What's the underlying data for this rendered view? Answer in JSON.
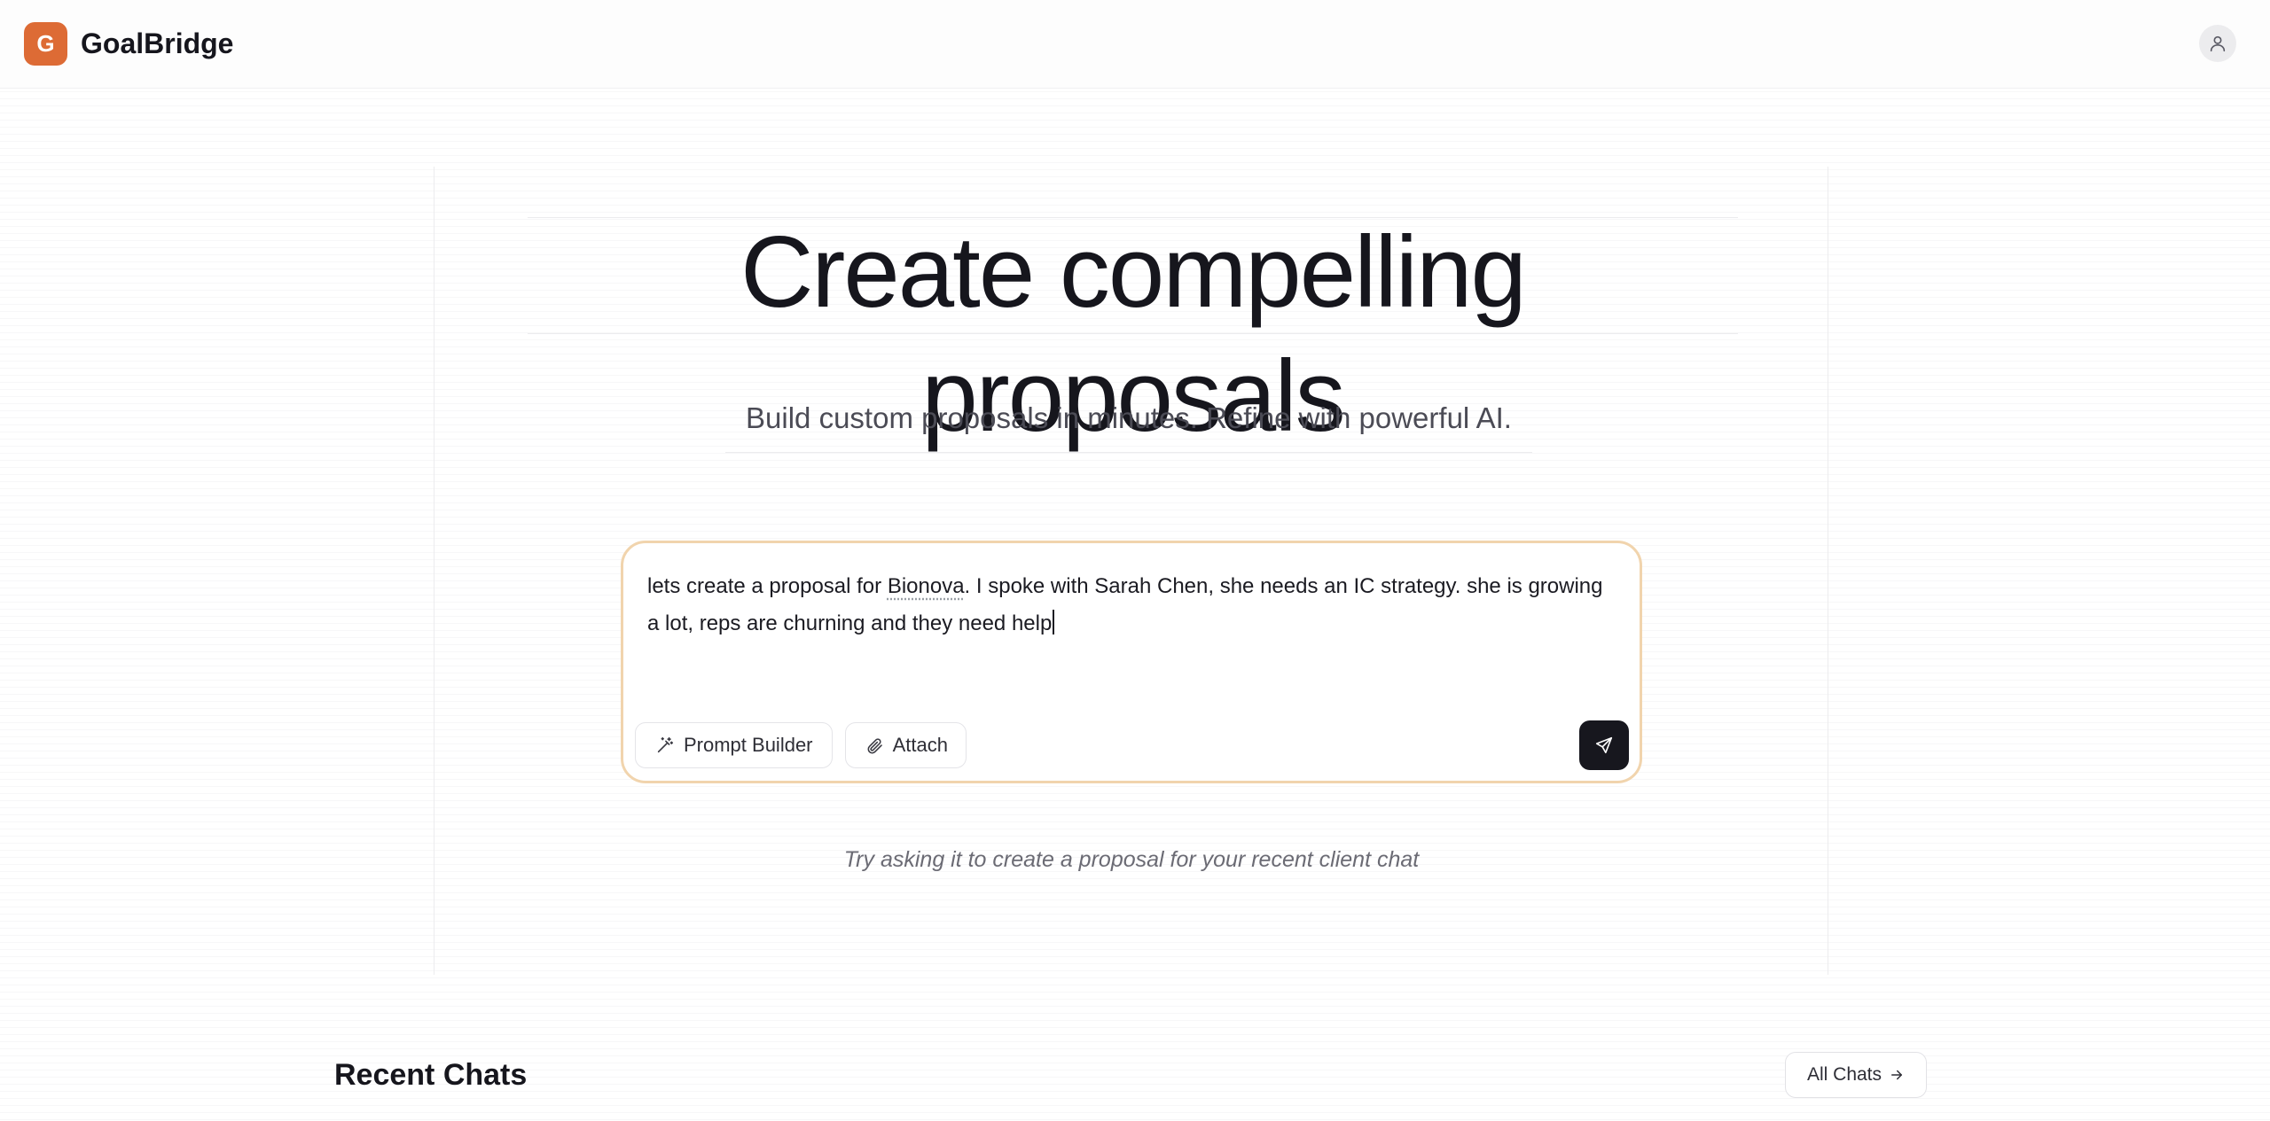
{
  "header": {
    "logo_letter": "G",
    "brand_name": "GoalBridge",
    "user_icon": "user-icon"
  },
  "hero": {
    "title": "Create compelling proposals",
    "subtitle": "Build custom proposals in minutes. Refine with powerful AI."
  },
  "composer": {
    "value_before": "lets create a proposal for ",
    "value_misspelled": "Bionova",
    "value_after": ". I spoke with Sarah Chen, she needs an IC strategy. she is growing a lot, reps are churning and they need help",
    "prompt_builder_label": "Prompt Builder",
    "prompt_builder_icon": "magic-wand-icon",
    "attach_label": "Attach",
    "attach_icon": "paperclip-icon",
    "send_icon": "send-icon",
    "border_color": "#f1d4ad"
  },
  "hint": "Try asking it to create a proposal for your recent client chat",
  "recent": {
    "title": "Recent Chats",
    "all_chats_label": "All Chats",
    "all_chats_icon": "arrow-right-icon"
  },
  "colors": {
    "brand": "#dd6b35",
    "send_button": "#17171e"
  }
}
